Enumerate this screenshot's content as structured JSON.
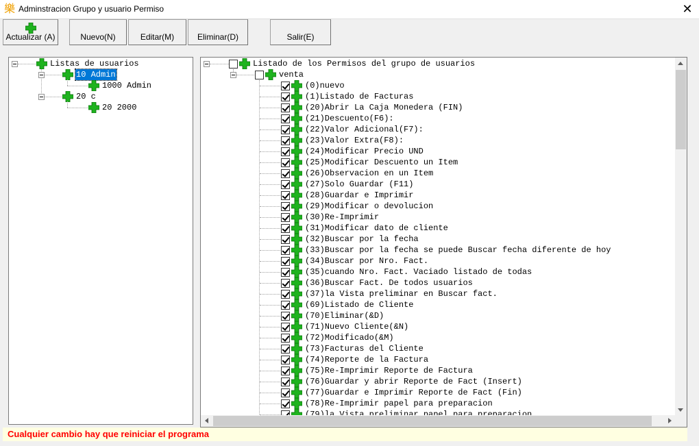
{
  "window": {
    "title": "Adminstracion Grupo y usuario Permiso",
    "close_glyph": "✕",
    "app_glyph": "樂"
  },
  "toolbar": {
    "refresh_label": "Actualizar (A)",
    "new_label": "Nuevo(N)",
    "edit_label": "Editar(M)",
    "delete_label": "Eliminar(D)",
    "exit_label": "Salir(E)"
  },
  "users_tree": {
    "root": "Listas de usuarios",
    "groups": [
      {
        "label": "10 Admin",
        "users": [
          "1000 Admin"
        ]
      },
      {
        "label": "20 c",
        "users": [
          "20 2000"
        ]
      }
    ]
  },
  "perm_tree": {
    "root": "Listado de los Permisos del grupo de usuarios",
    "group": "venta",
    "items": [
      "(0)nuevo",
      "(1)Listado de Facturas",
      "(20)Abrir La Caja Monedera (FIN)",
      "(21)Descuento(F6):",
      "(22)Valor Adicional(F7):",
      "(23)Valor Extra(F8):",
      "(24)Modificar Precio UND",
      "(25)Modificar Descuento un Item",
      "(26)Observacion en un Item",
      "(27)Solo Guardar (F11)",
      "(28)Guardar e Imprimir",
      "(29)Modificar o devolucion",
      "(30)Re-Imprimir",
      "(31)Modificar dato de cliente",
      "(32)Buscar por la fecha",
      "(33)Buscar por la fecha se puede Buscar fecha diferente de hoy",
      "(34)Buscar por Nro. Fact.",
      "(35)cuando Nro. Fact. Vaciado listado de todas",
      "(36)Buscar Fact. De todos usuarios",
      "(37)la Vista preliminar en Buscar fact.",
      "(69)Listado de Cliente",
      "(70)Eliminar(&D)",
      "(71)Nuevo Cliente(&N)",
      "(72)Modificado(&M)",
      "(73)Facturas del Cliente",
      "(74)Reporte de la Factura",
      "(75)Re-Imprimir Reporte de Factura",
      "(76)Guardar y abrir Reporte de Fact (Insert)",
      "(77)Guardar e Imprimir Reporte de Fact (Fin)",
      "(78)Re-Imprimir papel para preparacion",
      "(79)la Vista preliminar papel para preparacion"
    ]
  },
  "status": {
    "message": "Cualquier cambio hay que reiniciar el programa"
  },
  "colors": {
    "plus_green": "#1fb31f",
    "status_red": "#ff0000",
    "selection": "#0078d7"
  }
}
